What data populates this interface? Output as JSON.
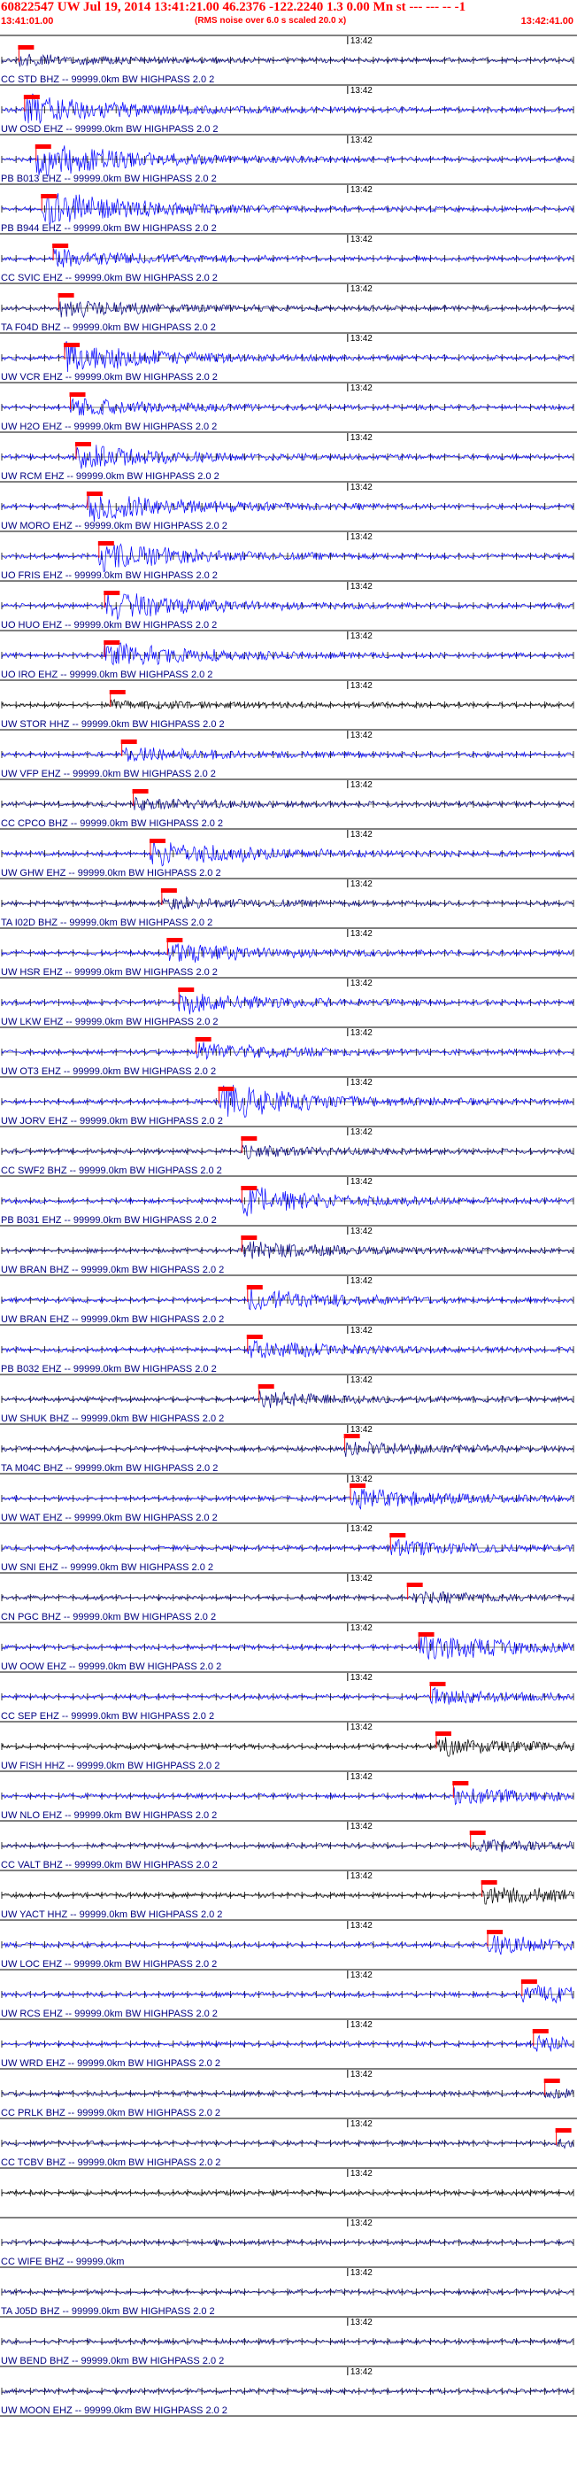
{
  "header": {
    "title": "60822547 UW Jul 19, 2014 13:41:21.00   46.2376 -122.2240  1.3 0.00 Mn st --- --- --  -1",
    "start_time": "13:41:01.00",
    "end_time": "13:42:41.00",
    "rms_note": "(RMS noise over 6.0 s scaled 20.0 x)"
  },
  "chart_data": {
    "type": "line",
    "time_start": "13:41:01.00",
    "time_end": "13:42:41.00",
    "time_marker": "13:42",
    "rms_window_s": 6.0,
    "rms_scale": 20.0,
    "traces": [
      {
        "label": "CC STD BHZ -- 99999.0km BW HIGHPASS  2.0  2",
        "color": "#000080",
        "pick": 0.03,
        "amp": 0.3
      },
      {
        "label": "UW OSD EHZ -- 99999.0km BW HIGHPASS  2.0  2",
        "color": "#0000ff",
        "pick": 0.04,
        "amp": 0.9
      },
      {
        "label": "PB B013 EHZ -- 99999.0km BW HIGHPASS  2.0  2",
        "color": "#0000ff",
        "pick": 0.06,
        "amp": 1.0
      },
      {
        "label": "PB B944 EHZ -- 99999.0km BW HIGHPASS  2.0  2",
        "color": "#0000ff",
        "pick": 0.07,
        "amp": 1.0
      },
      {
        "label": "CC SVIC EHZ -- 99999.0km BW HIGHPASS  2.0  2",
        "color": "#0000ff",
        "pick": 0.09,
        "amp": 0.5
      },
      {
        "label": "TA F04D BHZ -- 99999.0km BW HIGHPASS  2.0  2",
        "color": "#000080",
        "pick": 0.1,
        "amp": 0.5
      },
      {
        "label": "UW VCR EHZ -- 99999.0km BW HIGHPASS  2.0  2",
        "color": "#0000ff",
        "pick": 0.11,
        "amp": 0.9
      },
      {
        "label": "UW H2O EHZ -- 99999.0km BW HIGHPASS  2.0  2",
        "color": "#0000ff",
        "pick": 0.12,
        "amp": 0.5
      },
      {
        "label": "UW RCM EHZ -- 99999.0km BW HIGHPASS  2.0  2",
        "color": "#0000ff",
        "pick": 0.13,
        "amp": 0.7
      },
      {
        "label": "UW MORO EHZ -- 99999.0km BW HIGHPASS  2.0  2",
        "color": "#0000ff",
        "pick": 0.15,
        "amp": 0.9
      },
      {
        "label": "UO FRIS EHZ -- 99999.0km BW HIGHPASS  2.0  2",
        "color": "#0000ff",
        "pick": 0.17,
        "amp": 0.8
      },
      {
        "label": "UO HUO EHZ -- 99999.0km BW HIGHPASS  2.0  2",
        "color": "#0000ff",
        "pick": 0.18,
        "amp": 0.8
      },
      {
        "label": "UO IRO EHZ -- 99999.0km BW HIGHPASS  2.0  2",
        "color": "#0000ff",
        "pick": 0.18,
        "amp": 0.7
      },
      {
        "label": "UW STOR HHZ -- 99999.0km BW HIGHPASS  2.0  2",
        "color": "#000000",
        "pick": 0.19,
        "amp": 0.2
      },
      {
        "label": "UW VFP EHZ -- 99999.0km BW HIGHPASS  2.0  2",
        "color": "#0000ff",
        "pick": 0.21,
        "amp": 0.4
      },
      {
        "label": "CC CPCO BHZ -- 99999.0km BW HIGHPASS  2.0  2",
        "color": "#000080",
        "pick": 0.23,
        "amp": 0.3
      },
      {
        "label": "UW GHW EHZ -- 99999.0km BW HIGHPASS  2.0  2",
        "color": "#0000ff",
        "pick": 0.26,
        "amp": 0.8
      },
      {
        "label": "TA I02D BHZ -- 99999.0km BW HIGHPASS  2.0  2",
        "color": "#000080",
        "pick": 0.28,
        "amp": 0.3
      },
      {
        "label": "UW HSR EHZ -- 99999.0km BW HIGHPASS  2.0  2",
        "color": "#0000ff",
        "pick": 0.29,
        "amp": 0.6
      },
      {
        "label": "UW LKW EHZ -- 99999.0km BW HIGHPASS  2.0  2",
        "color": "#0000ff",
        "pick": 0.31,
        "amp": 0.6
      },
      {
        "label": "UW OT3 EHZ -- 99999.0km BW HIGHPASS  2.0  2",
        "color": "#0000ff",
        "pick": 0.34,
        "amp": 0.5
      },
      {
        "label": "UW JORV EHZ -- 99999.0km BW HIGHPASS  2.0  2",
        "color": "#0000ff",
        "pick": 0.38,
        "amp": 1.0
      },
      {
        "label": "CC SWF2 BHZ -- 99999.0km BW HIGHPASS  2.0  2",
        "color": "#000080",
        "pick": 0.42,
        "amp": 0.3
      },
      {
        "label": "PB B031 EHZ -- 99999.0km BW HIGHPASS  2.0  2",
        "color": "#0000ff",
        "pick": 0.42,
        "amp": 0.8
      },
      {
        "label": "UW BRAN BHZ -- 99999.0km BW HIGHPASS  2.0  2",
        "color": "#000080",
        "pick": 0.42,
        "amp": 0.5
      },
      {
        "label": "UW BRAN EHZ -- 99999.0km BW HIGHPASS  2.0  2",
        "color": "#0000ff",
        "pick": 0.43,
        "amp": 0.6
      },
      {
        "label": "PB B032 EHZ -- 99999.0km BW HIGHPASS  2.0  2",
        "color": "#0000ff",
        "pick": 0.43,
        "amp": 0.5
      },
      {
        "label": "UW SHUK BHZ -- 99999.0km BW HIGHPASS  2.0  2",
        "color": "#000080",
        "pick": 0.45,
        "amp": 0.4
      },
      {
        "label": "TA M04C BHZ -- 99999.0km BW HIGHPASS  2.0  2",
        "color": "#000080",
        "pick": 0.6,
        "amp": 0.4
      },
      {
        "label": "UW WAT EHZ -- 99999.0km BW HIGHPASS  2.0  2",
        "color": "#0000ff",
        "pick": 0.61,
        "amp": 0.6
      },
      {
        "label": "UW SNI EHZ -- 99999.0km BW HIGHPASS  2.0  2",
        "color": "#0000ff",
        "pick": 0.68,
        "amp": 0.4
      },
      {
        "label": "CN PGC BHZ -- 99999.0km BW HIGHPASS  2.0  2",
        "color": "#000080",
        "pick": 0.71,
        "amp": 0.3
      },
      {
        "label": "UW OOW EHZ -- 99999.0km BW HIGHPASS  2.0  2",
        "color": "#0000ff",
        "pick": 0.73,
        "amp": 0.8
      },
      {
        "label": "CC SEP EHZ -- 99999.0km BW HIGHPASS  2.0  2",
        "color": "#0000ff",
        "pick": 0.75,
        "amp": 0.4
      },
      {
        "label": "UW FISH HHZ -- 99999.0km BW HIGHPASS  2.0  2",
        "color": "#000000",
        "pick": 0.76,
        "amp": 0.5
      },
      {
        "label": "UW NLO EHZ -- 99999.0km BW HIGHPASS  2.0  2",
        "color": "#0000ff",
        "pick": 0.79,
        "amp": 0.5
      },
      {
        "label": "CC VALT BHZ -- 99999.0km BW HIGHPASS  2.0  2",
        "color": "#000080",
        "pick": 0.82,
        "amp": 0.3
      },
      {
        "label": "UW YACT HHZ -- 99999.0km BW HIGHPASS  2.0  2",
        "color": "#000000",
        "pick": 0.84,
        "amp": 0.5
      },
      {
        "label": "UW LOC EHZ -- 99999.0km BW HIGHPASS  2.0  2",
        "color": "#0000ff",
        "pick": 0.85,
        "amp": 0.5
      },
      {
        "label": "UW RCS EHZ -- 99999.0km BW HIGHPASS  2.0  2",
        "color": "#0000ff",
        "pick": 0.91,
        "amp": 0.5
      },
      {
        "label": "UW WRD EHZ -- 99999.0km BW HIGHPASS  2.0  2",
        "color": "#0000ff",
        "pick": 0.93,
        "amp": 0.4
      },
      {
        "label": "CC PRLK BHZ -- 99999.0km BW HIGHPASS  2.0  2",
        "color": "#000080",
        "pick": 0.95,
        "amp": 0.2
      },
      {
        "label": "CC TCBV BHZ -- 99999.0km BW HIGHPASS  2.0  2",
        "color": "#000080",
        "pick": 0.97,
        "amp": 0.2
      },
      {
        "label": "",
        "color": "#000000",
        "pick": null,
        "amp": 0.05
      },
      {
        "label": "CC WIFE BHZ -- 99999.0km",
        "color": "#000080",
        "pick": null,
        "amp": 0.15
      },
      {
        "label": "TA J05D BHZ -- 99999.0km BW HIGHPASS  2.0  2",
        "color": "#000080",
        "pick": null,
        "amp": 0.2
      },
      {
        "label": "UW BEND BHZ -- 99999.0km BW HIGHPASS  2.0  2",
        "color": "#000080",
        "pick": null,
        "amp": 0.2
      },
      {
        "label": "UW MOON EHZ -- 99999.0km BW HIGHPASS  2.0  2",
        "color": "#000080",
        "pick": null,
        "amp": 0.2
      }
    ]
  }
}
